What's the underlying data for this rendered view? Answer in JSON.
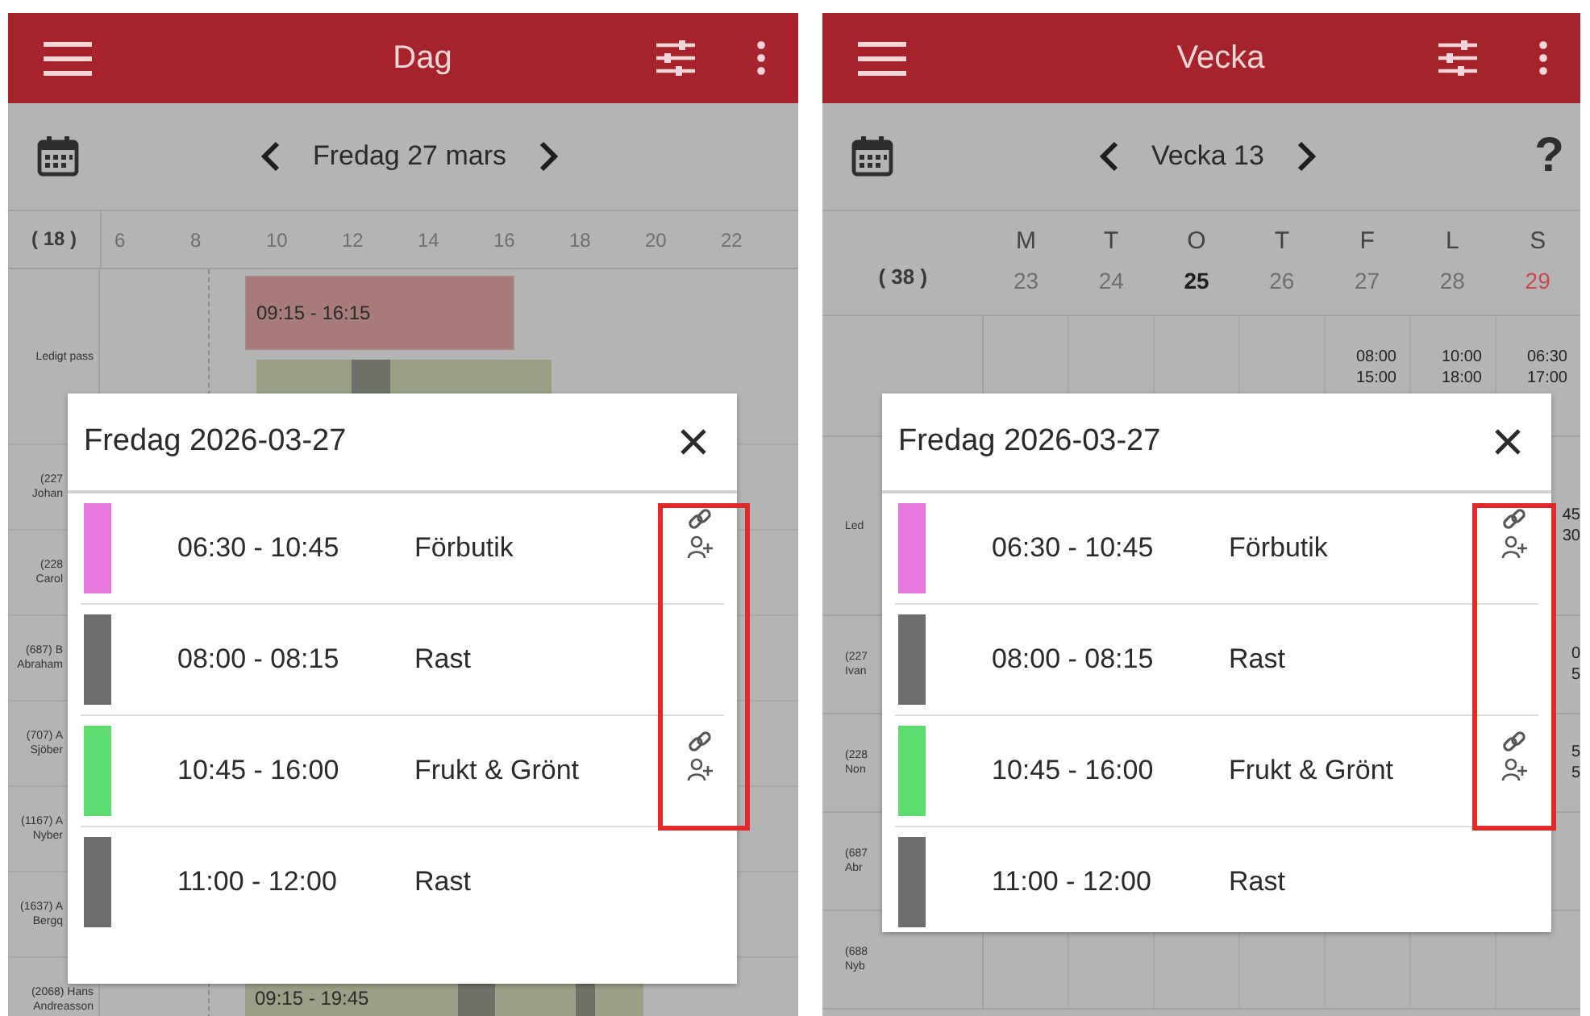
{
  "day_view": {
    "header": {
      "title": "Dag"
    },
    "nav": {
      "label": "Fredag 27 mars"
    },
    "timeline": {
      "count": "( 18 )",
      "hours": [
        "6",
        "8",
        "10",
        "12",
        "14",
        "16",
        "18",
        "20",
        "22"
      ]
    },
    "rows": [
      {
        "label": [
          "Ledigt pass"
        ],
        "bars": [
          {
            "kind": "open",
            "text": "09:15 - 16:15"
          },
          {
            "kind": "shift"
          },
          {
            "kind": "break"
          }
        ]
      },
      {
        "label": [
          "(227",
          "Johan"
        ]
      },
      {
        "label": [
          "(228",
          "Carol"
        ]
      },
      {
        "label": [
          "(687) B",
          "Abraham"
        ]
      },
      {
        "label": [
          "(707) A",
          "Sjöber"
        ]
      },
      {
        "label": [
          "(1167) A",
          "Nyber"
        ]
      },
      {
        "label": [
          "(1637) A",
          "Bergq"
        ]
      },
      {
        "label": [
          "(2068) Hans",
          "Andreasson"
        ],
        "bars": [
          {
            "kind": "shift",
            "text": "09:15 - 19:45"
          },
          {
            "kind": "break"
          },
          {
            "kind": "break"
          }
        ]
      }
    ],
    "dialog": {
      "title": "Fredag 2026-03-27",
      "entries": [
        {
          "time": "06:30 - 10:45",
          "label": "Förbutik",
          "color": "#e678de",
          "linked": true
        },
        {
          "time": "08:00 - 08:15",
          "label": "Rast",
          "color": "#6e6e6e",
          "linked": false
        },
        {
          "time": "10:45 - 16:00",
          "label": "Frukt & Grönt",
          "color": "#5ddc70",
          "linked": true
        },
        {
          "time": "11:00 - 12:00",
          "label": "Rast",
          "color": "#6e6e6e",
          "linked": false
        }
      ]
    }
  },
  "week_view": {
    "header": {
      "title": "Vecka"
    },
    "nav": {
      "label": "Vecka 13",
      "help": "?"
    },
    "count": "( 38 )",
    "days": [
      {
        "letter": "M",
        "date": "23",
        "today": false,
        "sunday": false
      },
      {
        "letter": "T",
        "date": "24",
        "today": false,
        "sunday": false
      },
      {
        "letter": "O",
        "date": "25",
        "today": true,
        "sunday": false
      },
      {
        "letter": "T",
        "date": "26",
        "today": false,
        "sunday": false
      },
      {
        "letter": "F",
        "date": "27",
        "today": false,
        "sunday": false
      },
      {
        "letter": "L",
        "date": "28",
        "today": false,
        "sunday": false
      },
      {
        "letter": "S",
        "date": "29",
        "today": false,
        "sunday": true
      }
    ],
    "rows": [
      {
        "times": [
          [
            "08:00",
            "15:00"
          ],
          [
            "10:00",
            "18:00"
          ],
          [
            "06:30",
            "17:00"
          ]
        ]
      },
      {
        "label": [
          "Led"
        ],
        "times": [
          [
            "45",
            "30"
          ]
        ]
      },
      {
        "label": [
          "(227",
          "Ivan"
        ],
        "times": [
          [
            "0",
            "5"
          ]
        ]
      },
      {
        "label": [
          "(228",
          "Non"
        ],
        "times": [
          [
            "5",
            "5"
          ]
        ]
      },
      {
        "label": [
          "(687",
          "Abr"
        ]
      },
      {
        "label": [
          "(688",
          "Nyb"
        ]
      }
    ],
    "dialog": {
      "title": "Fredag 2026-03-27",
      "entries": [
        {
          "time": "06:30 - 10:45",
          "label": "Förbutik",
          "color": "#e678de",
          "linked": true
        },
        {
          "time": "08:00 - 08:15",
          "label": "Rast",
          "color": "#6e6e6e",
          "linked": false
        },
        {
          "time": "10:45 - 16:00",
          "label": "Frukt & Grönt",
          "color": "#5ddc70",
          "linked": true
        },
        {
          "time": "11:00 - 12:00",
          "label": "Rast",
          "color": "#6e6e6e",
          "linked": false
        }
      ]
    }
  }
}
